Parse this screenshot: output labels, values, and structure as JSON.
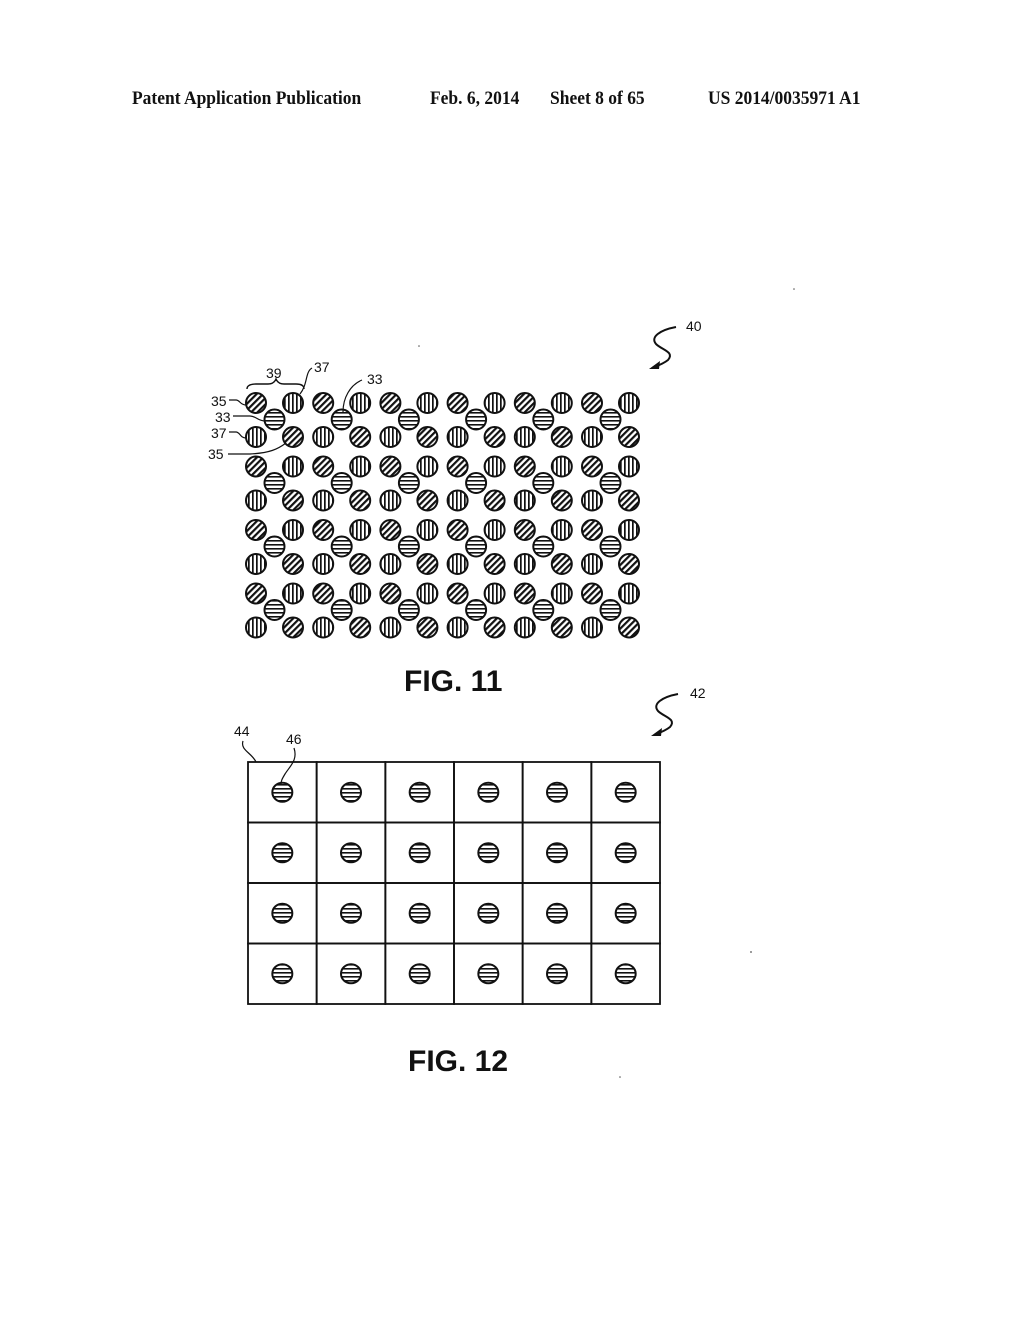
{
  "header": {
    "publication": "Patent Application Publication",
    "date": "Feb. 6, 2014",
    "sheet": "Sheet 8 of 65",
    "number": "US 2014/0035971 A1"
  },
  "fig11": {
    "title": "FIG. 11",
    "ref_main": "40",
    "unit_columns": 6,
    "unit_rows": 4,
    "unit_pattern": [
      {
        "position": "top-left",
        "hatch": "diagonal"
      },
      {
        "position": "top-right",
        "hatch": "vertical"
      },
      {
        "position": "center",
        "hatch": "horizontal"
      },
      {
        "position": "bottom-left",
        "hatch": "vertical"
      },
      {
        "position": "bottom-right",
        "hatch": "diagonal"
      }
    ],
    "labels": {
      "group": "39",
      "vertical_top": "37",
      "horizontal_second": "33",
      "diagonal_top": "35",
      "horizontal_center": "33",
      "vertical_bottom": "37",
      "diagonal_bottom": "35"
    }
  },
  "fig12": {
    "title": "FIG. 12",
    "ref_main": "42",
    "ref_cell": "44",
    "ref_dot": "46",
    "columns": 6,
    "rows": 4,
    "dot_hatch": "horizontal"
  }
}
